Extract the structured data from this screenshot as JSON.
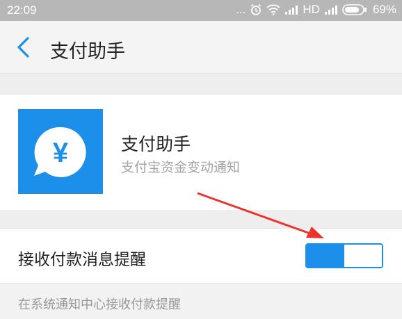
{
  "status_bar": {
    "time": "22:09",
    "dots": "...",
    "network": "HD",
    "battery": "69%"
  },
  "header": {
    "title": "支付助手",
    "back_icon": "chevron-left-icon"
  },
  "app": {
    "name": "支付助手",
    "description": "支付宝资金变动通知",
    "icon_glyph": "¥",
    "icon_color": "#1c8fea"
  },
  "setting": {
    "label": "接收付款消息提醒",
    "enabled": true,
    "hint": "在系统通知中心接收付款提醒"
  },
  "colors": {
    "accent": "#1c8fea",
    "annotation_arrow": "#e8352d"
  }
}
